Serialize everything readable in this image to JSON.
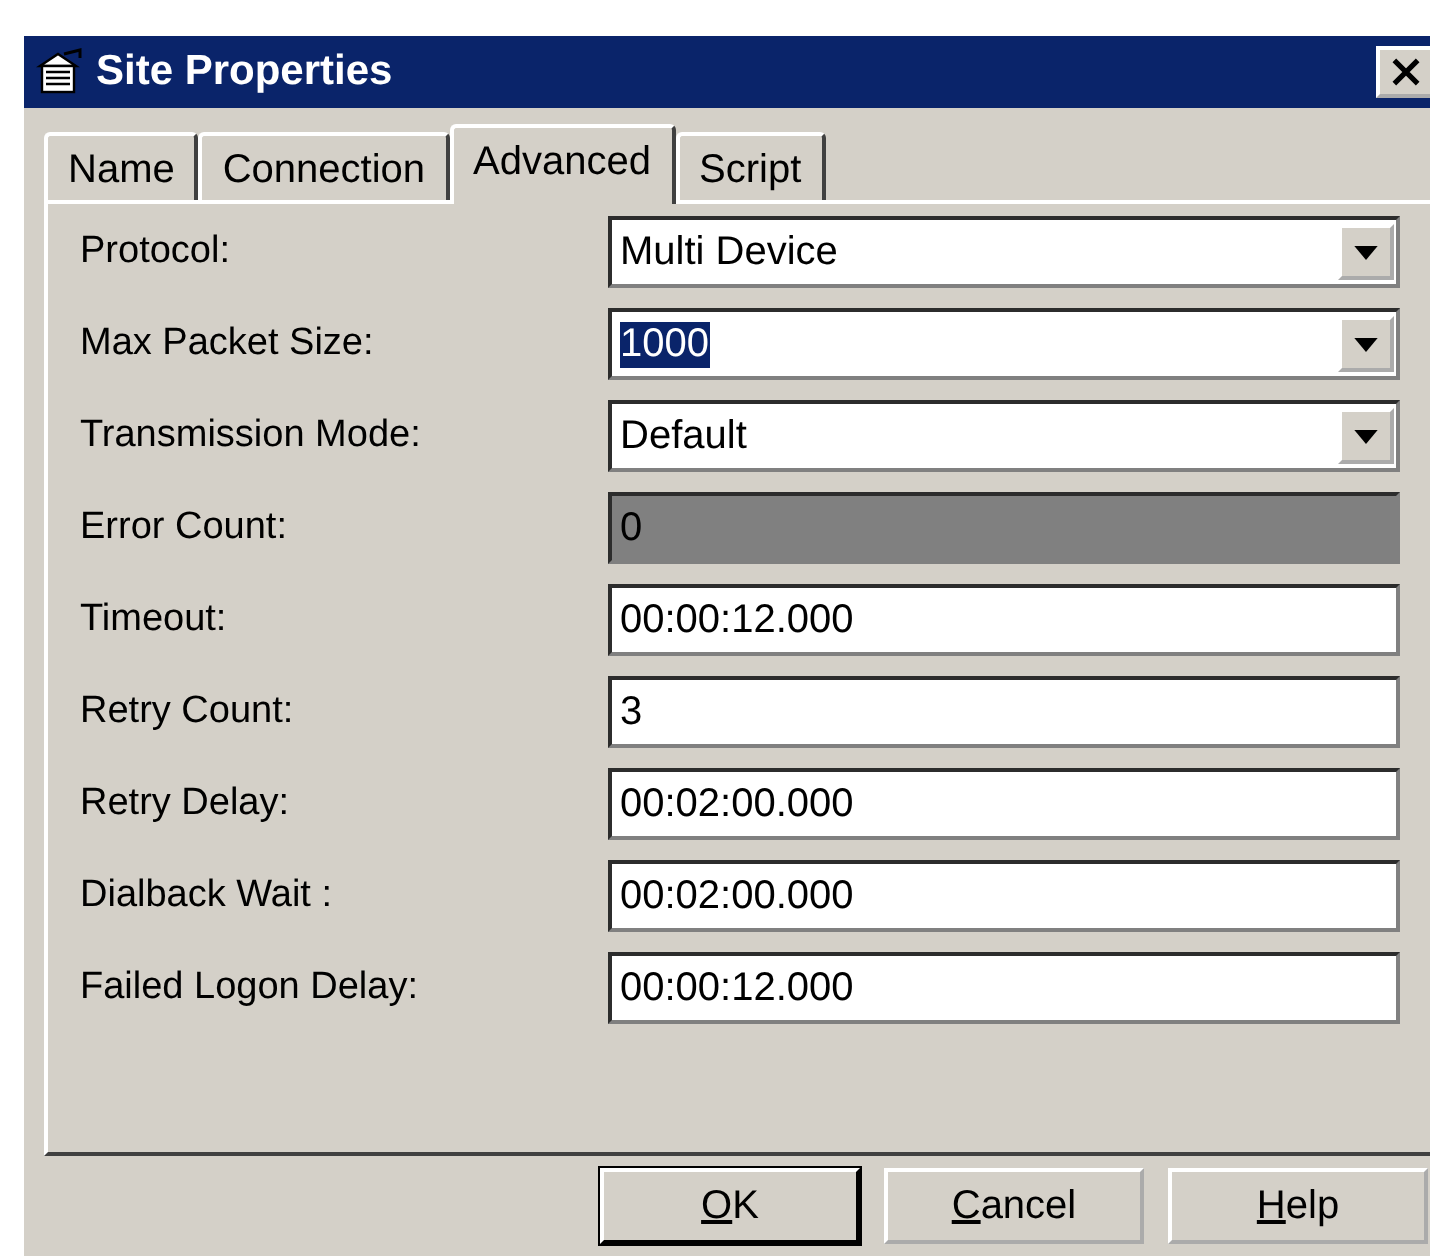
{
  "window": {
    "title": "Site Properties"
  },
  "tabs": [
    {
      "label": "Name",
      "selected": false
    },
    {
      "label": "Connection",
      "selected": false
    },
    {
      "label": "Advanced",
      "selected": true
    },
    {
      "label": "Script",
      "selected": false
    }
  ],
  "fields": [
    {
      "label": "Protocol:",
      "kind": "dropdown",
      "value": "Multi Device",
      "disabled": false,
      "text_selected": false
    },
    {
      "label": "Max Packet Size:",
      "kind": "dropdown",
      "value": "1000",
      "disabled": false,
      "text_selected": true
    },
    {
      "label": "Transmission Mode:",
      "kind": "dropdown",
      "value": "Default",
      "disabled": false,
      "text_selected": false
    },
    {
      "label": "Error Count:",
      "kind": "text",
      "value": "0",
      "disabled": true,
      "text_selected": false
    },
    {
      "label": "Timeout:",
      "kind": "text",
      "value": "00:00:12.000",
      "disabled": false,
      "text_selected": false
    },
    {
      "label": "Retry Count:",
      "kind": "text",
      "value": "3",
      "disabled": false,
      "text_selected": false
    },
    {
      "label": "Retry Delay:",
      "kind": "text",
      "value": "00:02:00.000",
      "disabled": false,
      "text_selected": false
    },
    {
      "label": "Dialback Wait :",
      "kind": "text",
      "value": "00:02:00.000",
      "disabled": false,
      "text_selected": false
    },
    {
      "label": "Failed Logon Delay:",
      "kind": "text",
      "value": "00:00:12.000",
      "disabled": false,
      "text_selected": false
    }
  ],
  "buttons": [
    {
      "access_key": "O",
      "rest": "K",
      "default": true
    },
    {
      "access_key": "C",
      "rest": "ancel",
      "default": false
    },
    {
      "access_key": "H",
      "rest": "elp",
      "default": false
    }
  ]
}
